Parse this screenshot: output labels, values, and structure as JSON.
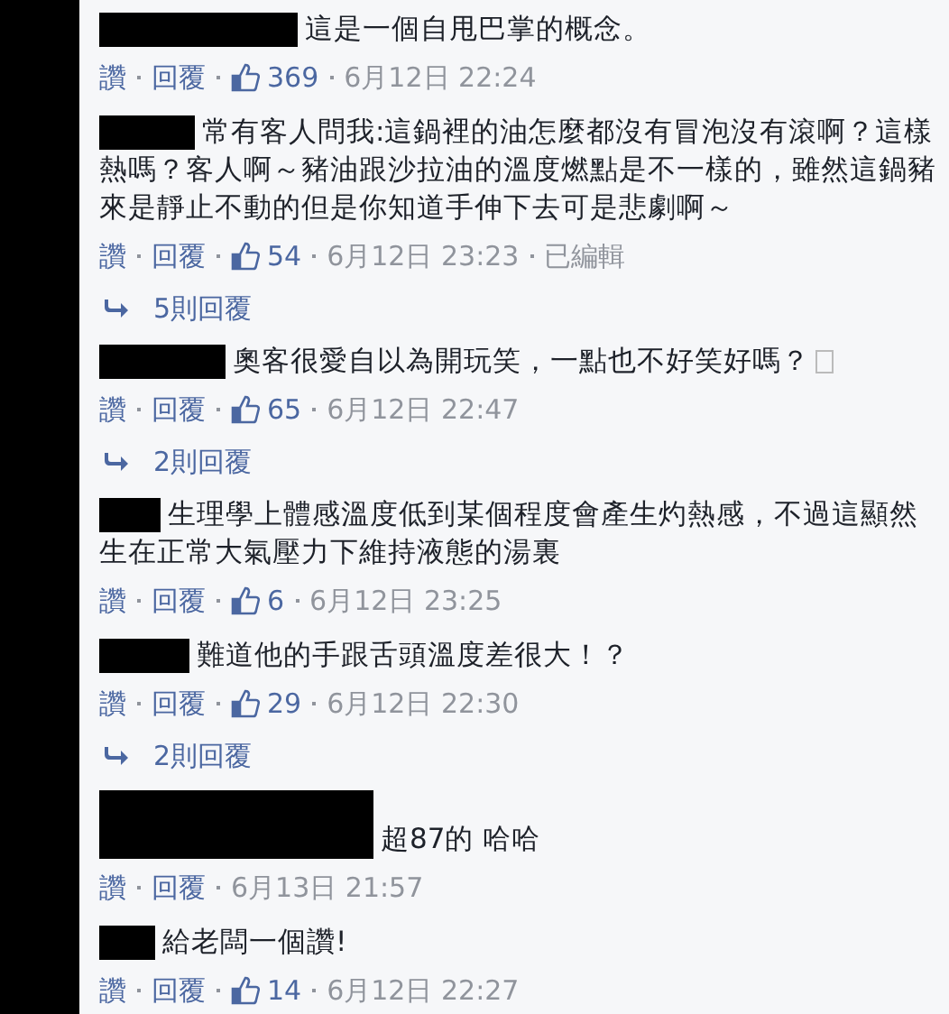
{
  "comments": [
    {
      "author": {
        "redacted": true
      },
      "lines": [
        "這是一個自甩巴掌的概念。"
      ],
      "actions": [
        "讚",
        "回覆"
      ],
      "likes": "369",
      "time": "6月12日 22:24"
    },
    {
      "author": {
        "redacted": true
      },
      "lines": [
        "常有客人問我:這鍋裡的油怎麼都沒有冒泡沒有滾啊？這樣",
        "熱嗎？客人啊～豬油跟沙拉油的溫度燃點是不一樣的，雖然這鍋豬",
        "來是靜止不動的但是你知道手伸下去可是悲劇啊～"
      ],
      "actions": [
        "讚",
        "回覆"
      ],
      "likes": "54",
      "time": "6月12日 23:23",
      "edited": "已編輯",
      "replies": "5則回覆"
    },
    {
      "author": {
        "redacted": true
      },
      "lines": [
        "奧客很愛自以為開玩笑，一點也不好笑好嗎？"
      ],
      "missing_glyph": true,
      "actions": [
        "讚",
        "回覆"
      ],
      "likes": "65",
      "time": "6月12日 22:47",
      "replies": "2則回覆"
    },
    {
      "author": {
        "redacted": true
      },
      "lines": [
        "生理學上體感溫度低到某個程度會產生灼熱感，不過這顯然",
        "生在正常大氣壓力下維持液態的湯裏"
      ],
      "actions": [
        "讚",
        "回覆"
      ],
      "likes": "6",
      "time": "6月12日 23:25"
    },
    {
      "author": {
        "redacted": true
      },
      "lines": [
        "難道他的手跟舌頭溫度差很大！？"
      ],
      "actions": [
        "讚",
        "回覆"
      ],
      "likes": "29",
      "time": "6月12日 22:30",
      "replies": "2則回覆"
    },
    {
      "author": {
        "redacted": true
      },
      "lines": [
        "超87的 哈哈"
      ],
      "actions": [
        "讚",
        "回覆"
      ],
      "time": "6月13日 21:57"
    },
    {
      "author": {
        "redacted": true
      },
      "lines": [
        "給老闆一個讚!"
      ],
      "actions": [
        "讚",
        "回覆"
      ],
      "likes": "14",
      "time": "6月12日 22:27"
    }
  ]
}
